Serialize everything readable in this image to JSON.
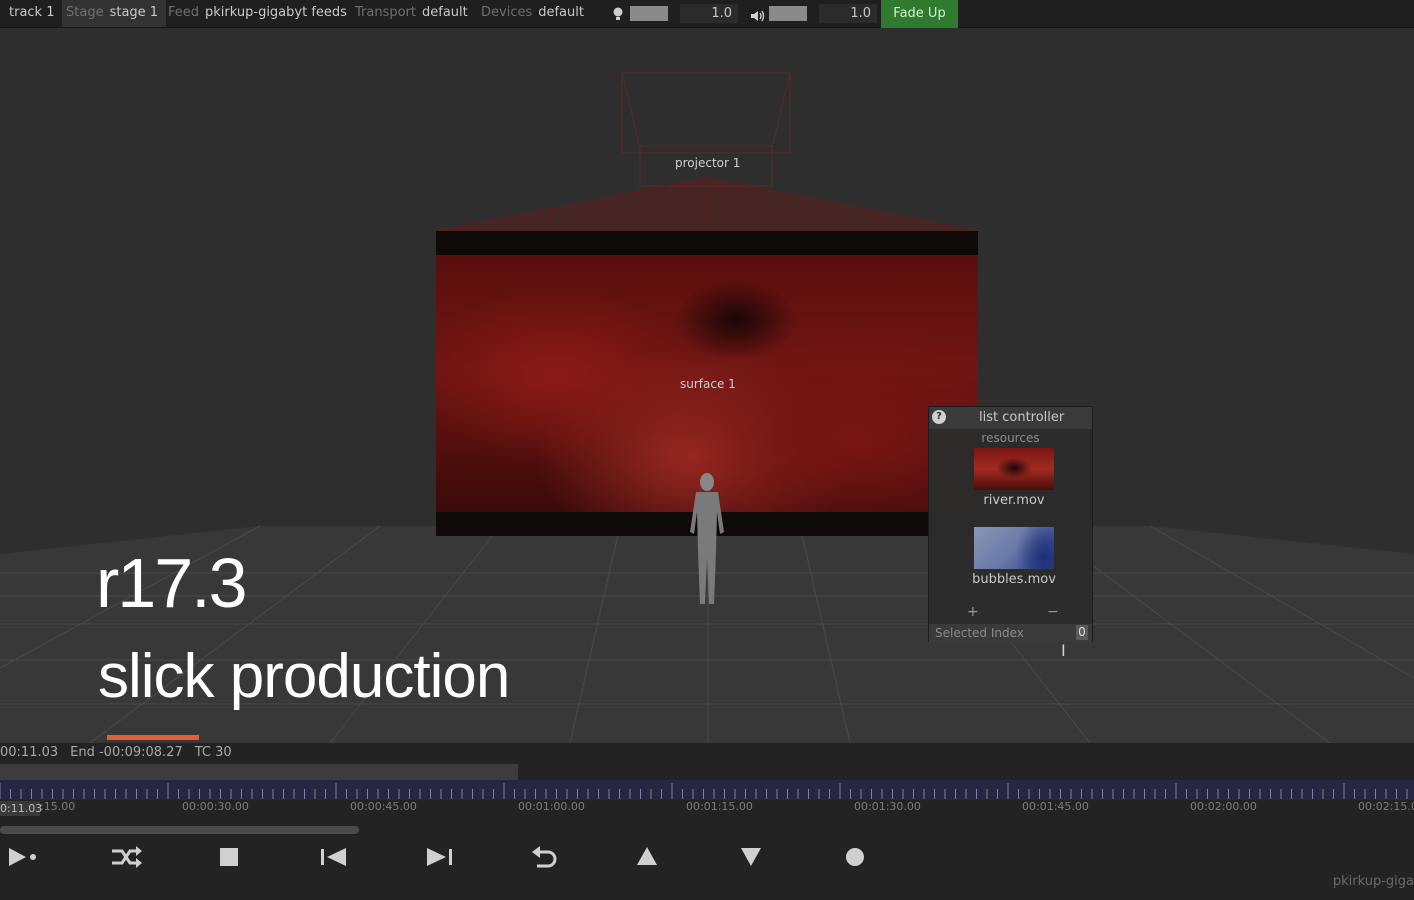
{
  "toolbar": {
    "track": "track 1",
    "stage_label": "Stage",
    "stage_value": "stage 1",
    "feed_label": "Feed",
    "feed_value": "pkirkup-gigabyt feeds",
    "transport_label": "Transport",
    "transport_value": "default",
    "devices_label": "Devices",
    "devices_value": "default",
    "brightness_value": "1.0",
    "volume_value": "1.0",
    "fade_button": "Fade Up"
  },
  "stage": {
    "projector_label": "projector 1",
    "surface_label": "surface 1"
  },
  "list_controller": {
    "title": "list controller",
    "subtitle": "resources",
    "items": [
      {
        "name": "river.mov"
      },
      {
        "name": "bubbles.mov"
      }
    ],
    "add_symbol": "+",
    "remove_symbol": "−",
    "selected_index_label": "Selected Index",
    "selected_index_value": "0"
  },
  "overlay": {
    "version": "r17.3",
    "tagline": "slick production",
    "accent_color": "#e0603a"
  },
  "timeline": {
    "current": "00:11.03",
    "end": "End -00:09:08.27",
    "tc": "TC 30",
    "playhead": "0:11.03",
    "time_labels": [
      ":15.00",
      "00:00:30.00",
      "00:00:45.00",
      "00:01:00.00",
      "00:01:15.00",
      "00:01:30.00",
      "00:01:45.00",
      "00:02:00.00",
      "00:02:15.0"
    ],
    "ruler_color": "#262640"
  },
  "transport": {
    "buttons": [
      "play-icon",
      "loop-icon",
      "stop-icon",
      "previous-icon",
      "next-icon",
      "undo-icon",
      "up-icon",
      "down-icon",
      "record-icon"
    ]
  },
  "footer": {
    "name": "pkirkup-giga"
  }
}
